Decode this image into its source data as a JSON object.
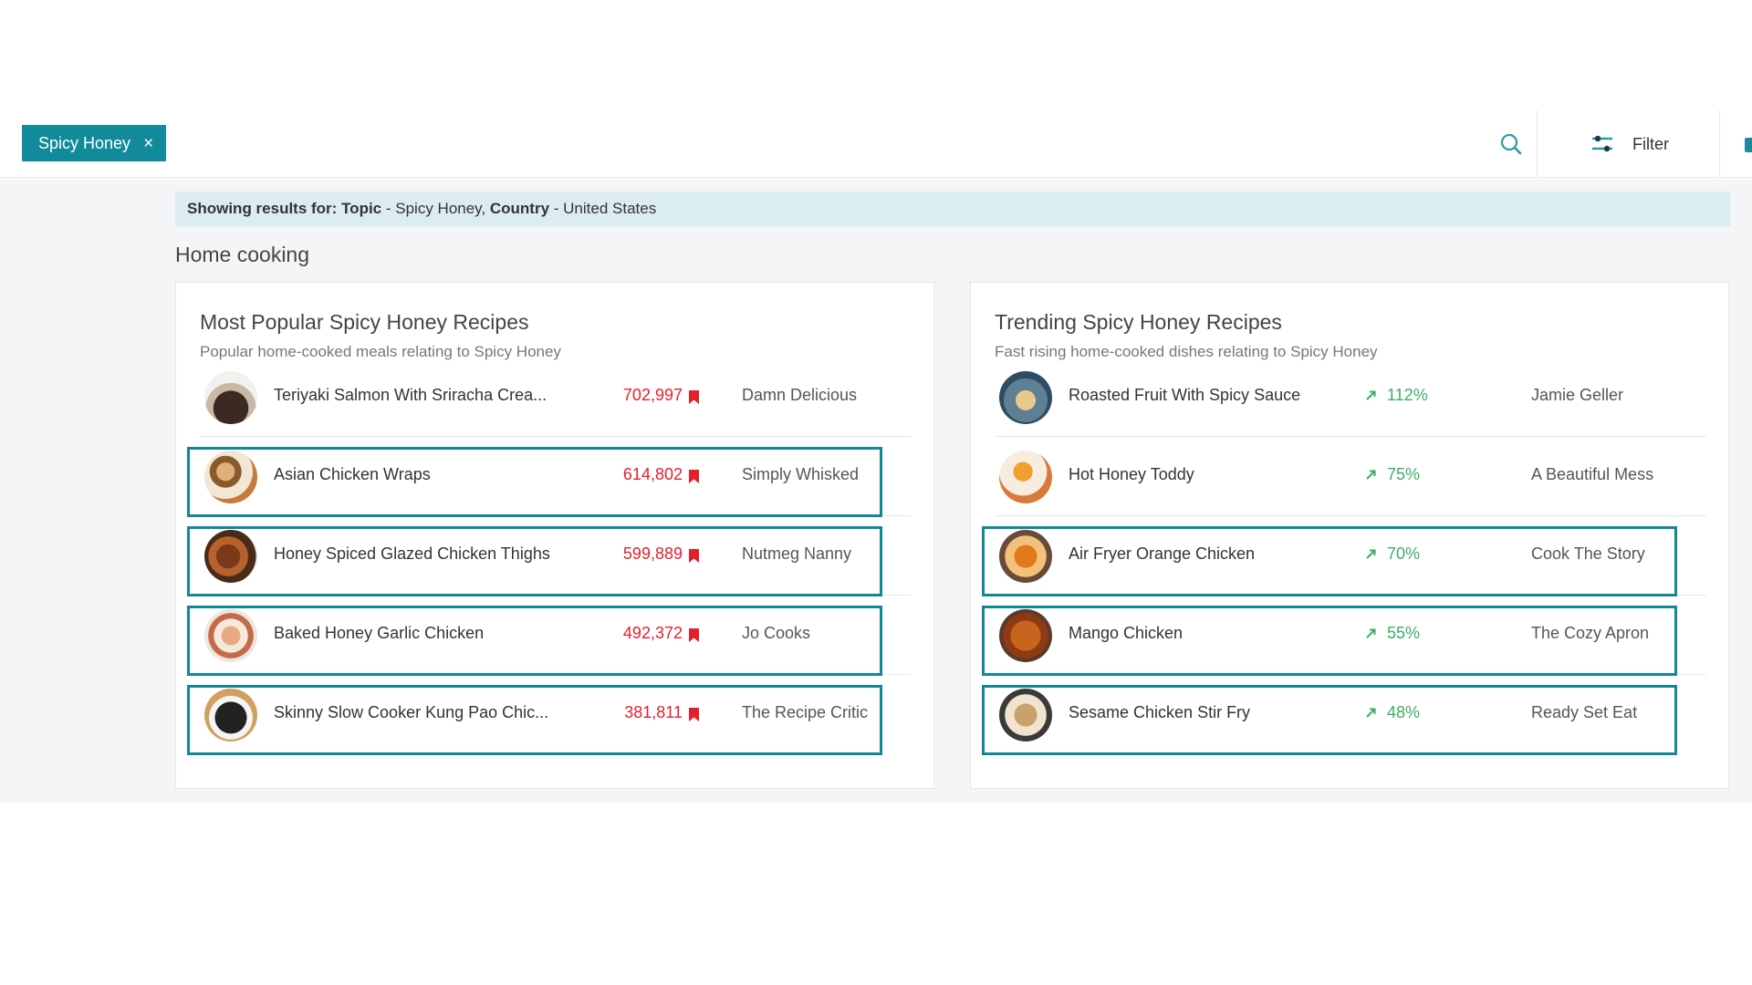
{
  "topbar": {
    "chip_label": "Spicy Honey",
    "chip_close": "×",
    "filter_label": "Filter"
  },
  "banner": {
    "prefix": "Showing results for: ",
    "topic_key": "Topic",
    "topic_value": " - Spicy Honey, ",
    "country_key": "Country",
    "country_value": " - United States"
  },
  "section_title": "Home cooking",
  "popular": {
    "title": "Most Popular Spicy Honey Recipes",
    "subtitle": "Popular home-cooked meals relating to Spicy Honey",
    "items": [
      {
        "title": "Teriyaki Salmon With Sriracha Crea...",
        "count": "702,997",
        "source": "Damn Delicious",
        "highlighted": false
      },
      {
        "title": "Asian Chicken Wraps",
        "count": "614,802",
        "source": "Simply Whisked",
        "highlighted": true
      },
      {
        "title": "Honey Spiced Glazed Chicken Thighs",
        "count": "599,889",
        "source": "Nutmeg Nanny",
        "highlighted": true
      },
      {
        "title": "Baked Honey Garlic Chicken",
        "count": "492,372",
        "source": "Jo Cooks",
        "highlighted": true
      },
      {
        "title": "Skinny Slow Cooker Kung Pao Chic...",
        "count": "381,811",
        "source": "The Recipe Critic",
        "highlighted": true
      }
    ]
  },
  "trending": {
    "title": "Trending Spicy Honey Recipes",
    "subtitle": "Fast rising home-cooked dishes relating to Spicy Honey",
    "items": [
      {
        "title": "Roasted Fruit With Spicy Sauce",
        "growth": "112%",
        "source": "Jamie Geller",
        "highlighted": false
      },
      {
        "title": "Hot Honey Toddy",
        "growth": "75%",
        "source": "A Beautiful Mess",
        "highlighted": false
      },
      {
        "title": "Air Fryer Orange Chicken",
        "growth": "70%",
        "source": "Cook The Story",
        "highlighted": true
      },
      {
        "title": "Mango Chicken",
        "growth": "55%",
        "source": "The Cozy Apron",
        "highlighted": true
      },
      {
        "title": "Sesame Chicken Stir Fry",
        "growth": "48%",
        "source": "Ready Set Eat",
        "highlighted": true
      }
    ]
  },
  "colors": {
    "accent": "#118a99",
    "highlight_border": "#138795",
    "count_red": "#e4202d",
    "growth_green": "#3aae64",
    "banner_bg": "#dcedf1",
    "content_bg": "#f4f5f7"
  }
}
